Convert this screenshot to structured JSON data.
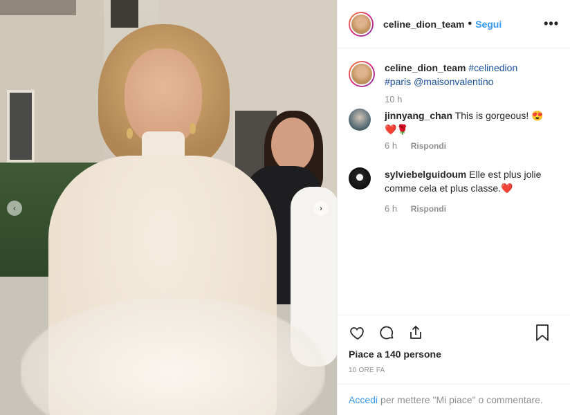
{
  "post": {
    "author": "celine_dion_team",
    "separator": "•",
    "follow_label": "Segui",
    "more_label": "•••"
  },
  "caption": {
    "username": "celine_dion_team",
    "hashtag1": "#celinedion",
    "hashtag2": "#paris",
    "mention": "@maisonvalentino",
    "time": "10 h"
  },
  "comments": [
    {
      "username": "jinnyang_chan",
      "text": "This is gorgeous! 😍 ❤️🌹",
      "time": "6 h",
      "reply_label": "Rispondi"
    },
    {
      "username": "sylviebelguidoum",
      "text": "Elle est plus jolie comme cela et plus classe.❤️",
      "time": "6 h",
      "reply_label": "Rispondi"
    }
  ],
  "actions": {
    "likes": "Piace a 140 persone",
    "posted": "10 ORE FA"
  },
  "login": {
    "link": "Accedi",
    "text": "per mettere \"Mi piace\" o commentare."
  },
  "carousel": {
    "prev_icon": "‹",
    "next_icon": "›"
  },
  "colors": {
    "accent": "#3897f0",
    "text": "#262626",
    "muted": "#8e8e8e",
    "border": "#efefef"
  }
}
